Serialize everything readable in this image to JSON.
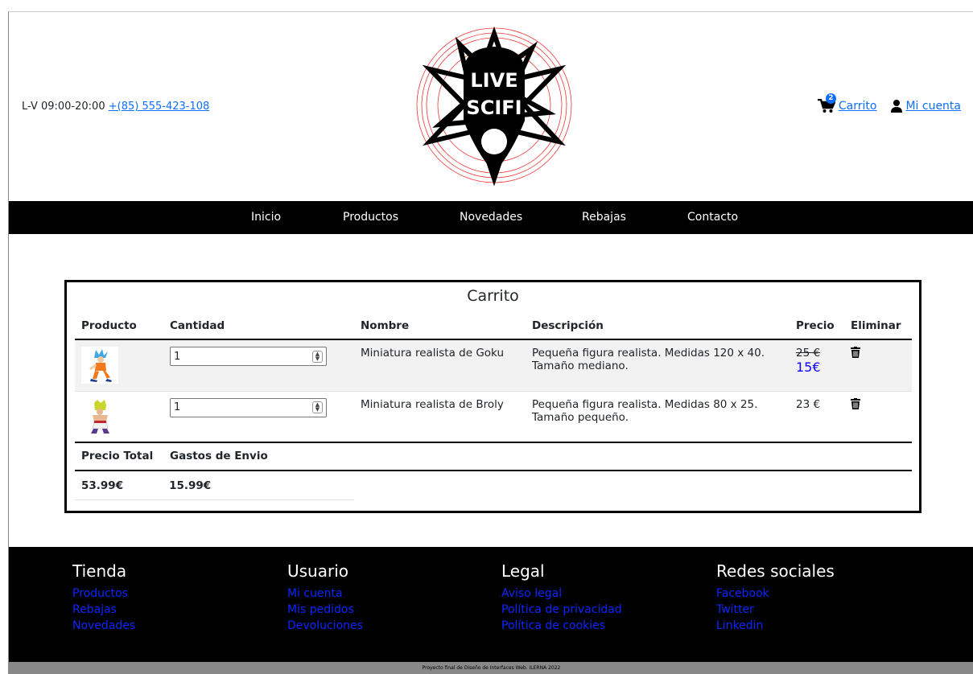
{
  "header": {
    "hours": "L-V 09:00-20:00",
    "phone": "+(85) 555-423-108",
    "logo_text": "LIVE SCIFI",
    "cart_count": "2",
    "cart_label": "Carrito",
    "account_label": "Mi cuenta"
  },
  "nav": {
    "items": [
      {
        "label": "Inicio"
      },
      {
        "label": "Productos"
      },
      {
        "label": "Novedades"
      },
      {
        "label": "Rebajas"
      },
      {
        "label": "Contacto"
      }
    ]
  },
  "cart": {
    "title": "Carrito",
    "columns": [
      "Producto",
      "Cantidad",
      "Nombre",
      "Descripción",
      "Precio",
      "Eliminar"
    ],
    "rows": [
      {
        "image_name": "goku-figure",
        "quantity": "1",
        "name": "Miniatura realista de Goku",
        "description": "Pequeña figura realista. Medidas 120 x 40. Tamaño mediano.",
        "old_price": "25 €",
        "price": "15€"
      },
      {
        "image_name": "broly-figure",
        "quantity": "1",
        "name": "Miniatura realista de Broly",
        "description": "Pequeña figura realista. Medidas 80 x 25. Tamaño pequeño.",
        "price": "23 €"
      }
    ],
    "totals": {
      "total_label": "Precio Total",
      "shipping_label": "Gastos de Envio",
      "total_value": "53.99€",
      "shipping_value": "15.99€"
    }
  },
  "footer": {
    "columns": [
      {
        "title": "Tienda",
        "links": [
          "Productos",
          "Rebajas",
          "Novedades"
        ]
      },
      {
        "title": "Usuario",
        "links": [
          "Mi cuenta",
          "Mis pedidos",
          "Devoluciones"
        ]
      },
      {
        "title": "Legal",
        "links": [
          "Aviso legal",
          "Política de privacidad",
          "Política de cookies"
        ]
      },
      {
        "title": "Redes sociales",
        "links": [
          "Facebook",
          "Twitter",
          "Linkedin"
        ]
      }
    ],
    "copyright": "Proyecto final de Diseño de Interfaces Web. ILERNA 2022"
  },
  "colors": {
    "link": "#0d6efd",
    "footer_link": "#0d26ff",
    "sale_price": "#0d00ff",
    "nav_bg": "#000000"
  }
}
